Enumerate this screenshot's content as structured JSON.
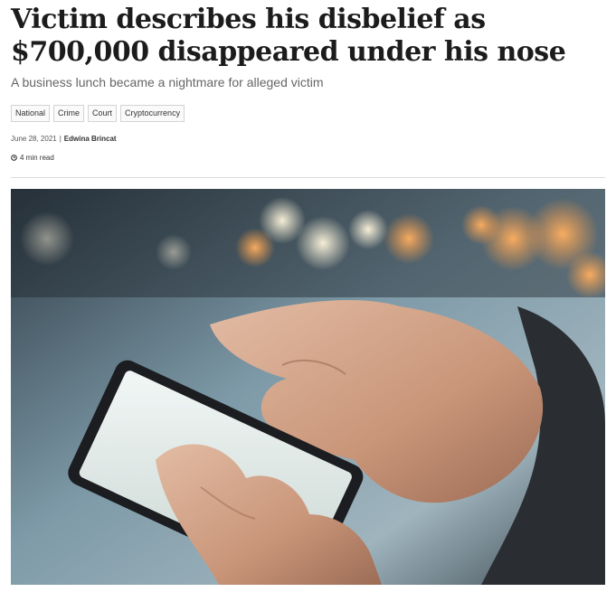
{
  "article": {
    "headline": "Victim describes his disbelief as $700,000 disappeared under his nose",
    "subtitle": "A business lunch became a nightmare for alleged victim",
    "tags": [
      "National",
      "Crime",
      "Court",
      "Cryptocurrency"
    ],
    "date": "June 28, 2021",
    "separator": "|",
    "author": "Edwina Brincat",
    "read_time": "4 min read"
  },
  "hero_image": {
    "icon": "smartphone-in-hands-photo"
  }
}
